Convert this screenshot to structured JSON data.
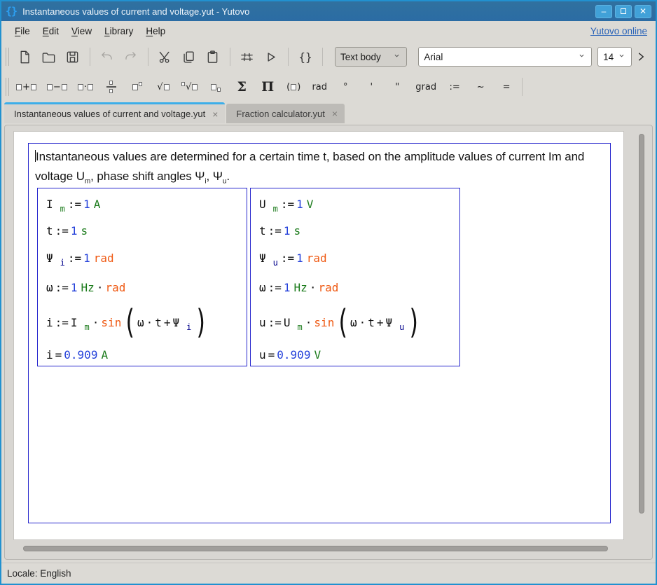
{
  "window": {
    "title": "Instantaneous values of current and voltage.yut - Yutovo",
    "logo_glyph": "{}",
    "buttons": [
      {
        "name": "minimize",
        "glyph": "minus"
      },
      {
        "name": "maximize",
        "glyph": "box"
      },
      {
        "name": "close",
        "glyph": "cross"
      }
    ]
  },
  "menubar": {
    "items": [
      {
        "name": "file",
        "label": "File",
        "mnemonic": 0
      },
      {
        "name": "edit",
        "label": "Edit",
        "mnemonic": 0
      },
      {
        "name": "view",
        "label": "View",
        "mnemonic": 0
      },
      {
        "name": "library",
        "label": "Library",
        "mnemonic": 0
      },
      {
        "name": "help",
        "label": "Help",
        "mnemonic": 0
      }
    ],
    "link": "Yutovo online"
  },
  "toolbar_main": {
    "buttons": [
      {
        "type": "btn",
        "name": "new-file",
        "disabled": false
      },
      {
        "type": "btn",
        "name": "open-file",
        "disabled": false
      },
      {
        "type": "btn",
        "name": "save-file",
        "disabled": false
      },
      {
        "type": "sep"
      },
      {
        "type": "btn",
        "name": "undo",
        "disabled": true
      },
      {
        "type": "btn",
        "name": "redo",
        "disabled": true
      },
      {
        "type": "sep"
      },
      {
        "type": "btn",
        "name": "cut",
        "disabled": false
      },
      {
        "type": "btn",
        "name": "copy",
        "disabled": false
      },
      {
        "type": "btn",
        "name": "paste",
        "disabled": false
      },
      {
        "type": "sep"
      },
      {
        "type": "btn",
        "name": "preferences",
        "disabled": false
      },
      {
        "type": "btn",
        "name": "run",
        "disabled": false
      },
      {
        "type": "sep"
      },
      {
        "type": "btn",
        "name": "braces",
        "disabled": false,
        "glyph": "{}"
      },
      {
        "type": "sep"
      }
    ],
    "style_select": "Text body",
    "font_select": "Arial",
    "size_select": "14"
  },
  "toolbar_math": {
    "items": [
      {
        "name": "plus-template",
        "tokens": [
          "b",
          "+",
          "b"
        ]
      },
      {
        "name": "minus-template",
        "tokens": [
          "b",
          "−",
          "b"
        ]
      },
      {
        "name": "multiply-template",
        "tokens": [
          "b",
          "·",
          "b"
        ]
      },
      {
        "name": "fraction-template",
        "tokens": [
          "frac"
        ]
      },
      {
        "name": "power-template",
        "tokens": [
          "b",
          "sup"
        ]
      },
      {
        "name": "sqrt-template",
        "tokens": [
          "√",
          "b"
        ]
      },
      {
        "name": "nth-root-template",
        "tokens": [
          "sup",
          "√",
          "b"
        ]
      },
      {
        "name": "subscript-template",
        "tokens": [
          "b",
          "sub"
        ]
      },
      {
        "name": "sum-template",
        "tokens": [
          "Σ"
        ],
        "big": true
      },
      {
        "name": "product-template",
        "tokens": [
          "Π"
        ],
        "big": true
      },
      {
        "name": "parentheses-template",
        "tokens": [
          "(",
          "b",
          ")"
        ]
      },
      {
        "name": "rad-unit",
        "tokens": [
          "rad"
        ]
      },
      {
        "name": "degree-unit",
        "tokens": [
          "°"
        ]
      },
      {
        "name": "arcminute-unit",
        "tokens": [
          "'"
        ]
      },
      {
        "name": "arcsecond-unit",
        "tokens": [
          "\""
        ]
      },
      {
        "name": "grad-unit",
        "tokens": [
          "grad"
        ]
      },
      {
        "name": "assign-operator",
        "tokens": [
          ":="
        ]
      },
      {
        "name": "tilde-operator",
        "tokens": [
          "~"
        ]
      },
      {
        "name": "equals-operator",
        "tokens": [
          "="
        ]
      }
    ]
  },
  "tabs": [
    {
      "name": "instantaneous-values",
      "label": "Instantaneous values of current and voltage.yut",
      "close": "×",
      "active": true
    },
    {
      "name": "fraction-calculator",
      "label": "Fraction calculator.yut",
      "close": "×",
      "active": false
    }
  ],
  "document": {
    "paragraph": [
      {
        "t": "Instantaneous values are determined for a certain time t, based on the amplitude values of current Im and voltage U"
      },
      {
        "t": "m",
        "s": 1
      },
      {
        "t": ", phase shift angles Ψ"
      },
      {
        "t": "i",
        "s": 1
      },
      {
        "t": ", Ψ"
      },
      {
        "t": "u",
        "s": 1
      },
      {
        "t": "."
      }
    ],
    "math_blocks": [
      {
        "name": "current-block",
        "lines": [
          [
            {
              "t": "I",
              "c": "var"
            },
            {
              "t": "m",
              "c": "unit",
              "s": 1
            },
            {
              "t": ":=",
              "c": "op"
            },
            {
              "t": "1",
              "c": "num"
            },
            {
              "t": "A",
              "c": "unit"
            }
          ],
          [
            {
              "t": "t",
              "c": "var"
            },
            {
              "t": ":=",
              "c": "op"
            },
            {
              "t": "1",
              "c": "num"
            },
            {
              "t": "s",
              "c": "unit"
            }
          ],
          [
            {
              "t": "Ψ",
              "c": "var"
            },
            {
              "t": "i",
              "c": "subvar",
              "s": 1
            },
            {
              "t": ":=",
              "c": "op"
            },
            {
              "t": "1",
              "c": "num"
            },
            {
              "t": "rad",
              "c": "fn"
            }
          ],
          [
            {
              "t": "ω",
              "c": "var"
            },
            {
              "t": ":=",
              "c": "op"
            },
            {
              "t": "1",
              "c": "num"
            },
            {
              "t": "Hz",
              "c": "unit"
            },
            {
              "t": "·",
              "c": "op"
            },
            {
              "t": "rad",
              "c": "fn"
            }
          ],
          [
            {
              "t": "i",
              "c": "var"
            },
            {
              "t": ":=",
              "c": "op"
            },
            {
              "t": "I",
              "c": "var"
            },
            {
              "t": "m",
              "c": "unit",
              "s": 1
            },
            {
              "t": "·",
              "c": "op"
            },
            {
              "t": "sin",
              "c": "fn"
            },
            {
              "t": "(",
              "c": "paren",
              "big": 1
            },
            {
              "t": "ω",
              "c": "var"
            },
            {
              "t": "·",
              "c": "op"
            },
            {
              "t": "t",
              "c": "var"
            },
            {
              "t": "+",
              "c": "op"
            },
            {
              "t": "Ψ",
              "c": "var"
            },
            {
              "t": "i",
              "c": "subvar",
              "s": 1
            },
            {
              "t": ")",
              "c": "paren",
              "big": 1
            }
          ],
          [
            {
              "t": "i",
              "c": "var"
            },
            {
              "t": "=",
              "c": "op"
            },
            {
              "t": "0.909",
              "c": "num"
            },
            {
              "t": "A",
              "c": "unit"
            }
          ]
        ]
      },
      {
        "name": "voltage-block",
        "lines": [
          [
            {
              "t": "U",
              "c": "var"
            },
            {
              "t": "m",
              "c": "unit",
              "s": 1
            },
            {
              "t": ":=",
              "c": "op"
            },
            {
              "t": "1",
              "c": "num"
            },
            {
              "t": "V",
              "c": "unit"
            }
          ],
          [
            {
              "t": "t",
              "c": "var"
            },
            {
              "t": ":=",
              "c": "op"
            },
            {
              "t": "1",
              "c": "num"
            },
            {
              "t": "s",
              "c": "unit"
            }
          ],
          [
            {
              "t": "Ψ",
              "c": "var"
            },
            {
              "t": "u",
              "c": "subvar",
              "s": 1
            },
            {
              "t": ":=",
              "c": "op"
            },
            {
              "t": "1",
              "c": "num"
            },
            {
              "t": "rad",
              "c": "fn"
            }
          ],
          [
            {
              "t": "ω",
              "c": "var"
            },
            {
              "t": ":=",
              "c": "op"
            },
            {
              "t": "1",
              "c": "num"
            },
            {
              "t": "Hz",
              "c": "unit"
            },
            {
              "t": "·",
              "c": "op"
            },
            {
              "t": "rad",
              "c": "fn"
            }
          ],
          [
            {
              "t": "u",
              "c": "var"
            },
            {
              "t": ":=",
              "c": "op"
            },
            {
              "t": "U",
              "c": "var"
            },
            {
              "t": "m",
              "c": "unit",
              "s": 1
            },
            {
              "t": "·",
              "c": "op"
            },
            {
              "t": "sin",
              "c": "fn"
            },
            {
              "t": "(",
              "c": "paren",
              "big": 1
            },
            {
              "t": "ω",
              "c": "var"
            },
            {
              "t": "·",
              "c": "op"
            },
            {
              "t": "t",
              "c": "var"
            },
            {
              "t": "+",
              "c": "op"
            },
            {
              "t": "Ψ",
              "c": "var"
            },
            {
              "t": "u",
              "c": "subvar",
              "s": 1
            },
            {
              "t": ")",
              "c": "paren",
              "big": 1
            }
          ],
          [
            {
              "t": "u",
              "c": "var"
            },
            {
              "t": "=",
              "c": "op"
            },
            {
              "t": "0.909",
              "c": "num"
            },
            {
              "t": "V",
              "c": "unit"
            }
          ]
        ]
      }
    ]
  },
  "statusbar": {
    "text": "Locale: English"
  },
  "colors": {
    "window_border": "#2191d0",
    "titlebar": "#2b6ca4",
    "chrome": "#dcdad5",
    "tab_accent": "#3daee9",
    "tab_inactive": "#bdbbb7",
    "link": "#2a63b8",
    "region_border": "#2626cd",
    "math_var": "#101010",
    "math_num": "#2441da",
    "math_unit": "#1d7c1d",
    "math_fn": "#ef5a14",
    "math_subvar": "#00008b"
  }
}
